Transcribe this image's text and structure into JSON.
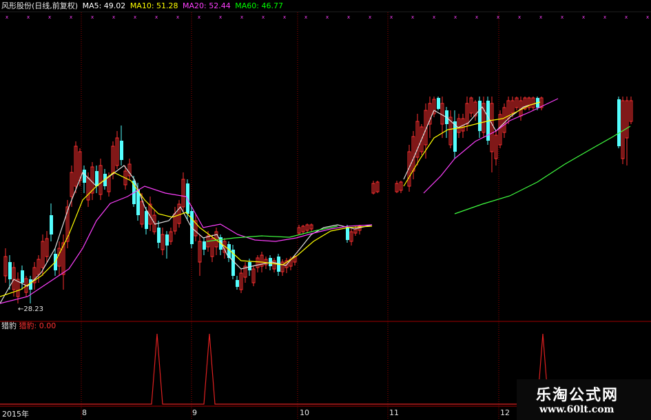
{
  "header": {
    "stock_name": "风形股份(日线,前复权)",
    "ma5_label": "MA5: 49.02",
    "ma10_label": "MA10: 51.28",
    "ma20_label": "MA20: 52.44",
    "ma60_label": "MA60: 46.77"
  },
  "indicator": {
    "name": "猎豹",
    "value_label": "猎豹: 0.00"
  },
  "price_annotation": "←28.23",
  "x_labels": [
    "2015年",
    "8",
    "9",
    "10",
    "11",
    "12"
  ],
  "watermark": {
    "line1": "乐淘公式网",
    "line2": "www.60lt.com"
  },
  "colors": {
    "background": "#000000",
    "up_candle": "#ff3030",
    "down_candle": "#54ffff",
    "ma5": "#ffffff",
    "ma10": "#ffff00",
    "ma20": "#ff40ff",
    "ma60": "#00ff00",
    "divider": "#a00000",
    "indicator_line": "#e02020"
  }
}
